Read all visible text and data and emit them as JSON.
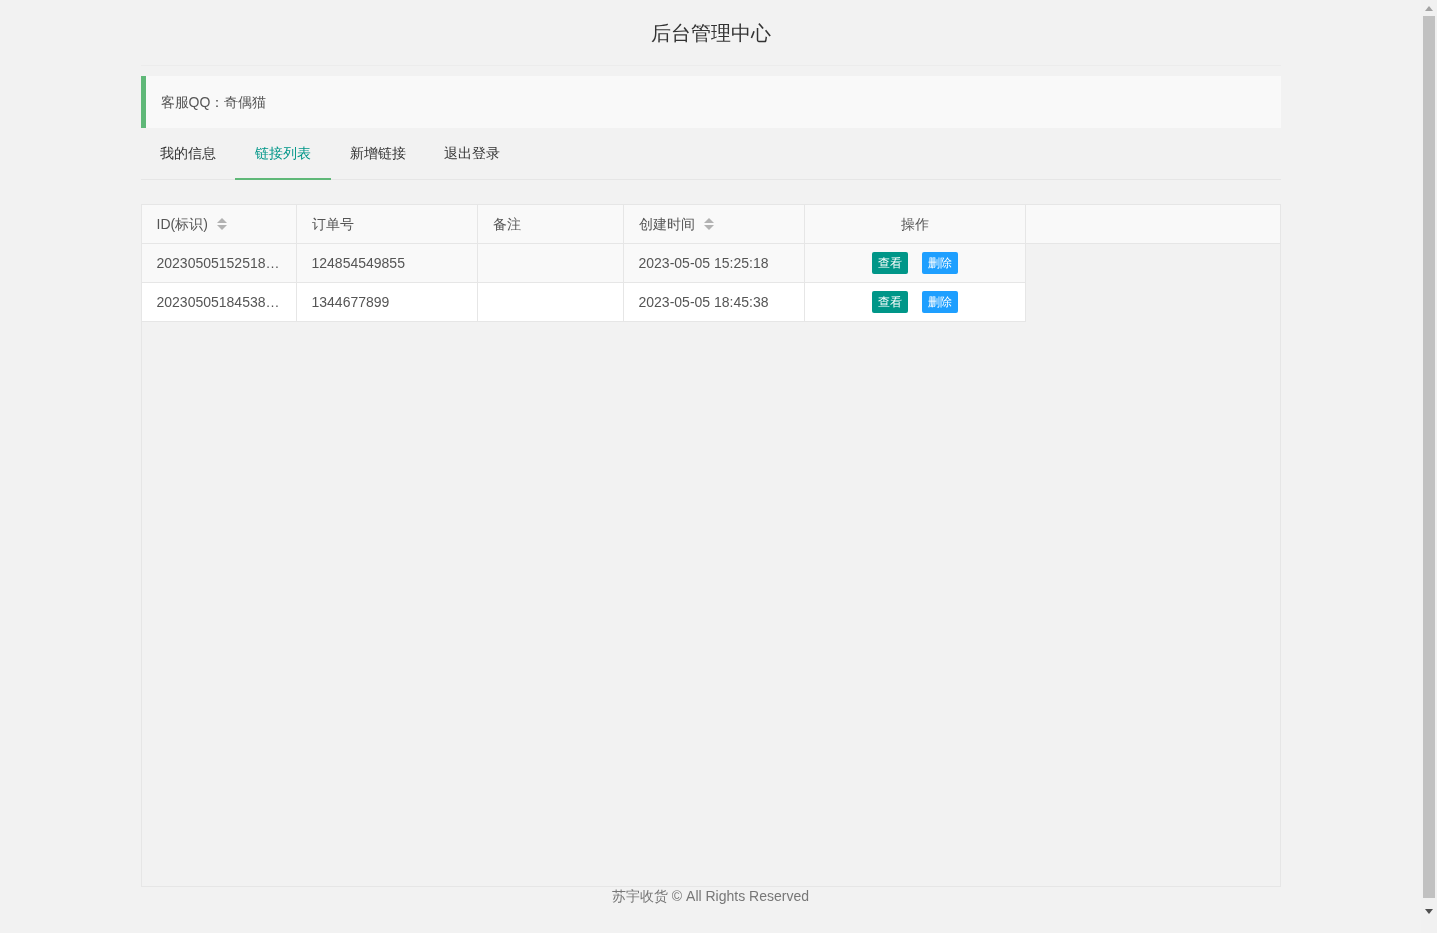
{
  "header": {
    "title": "后台管理中心"
  },
  "notice": {
    "text": "客服QQ：奇偶猫"
  },
  "tabs": [
    {
      "label": "我的信息",
      "selected": false
    },
    {
      "label": "链接列表",
      "selected": true
    },
    {
      "label": "新增链接",
      "selected": false
    },
    {
      "label": "退出登录",
      "selected": false
    }
  ],
  "table": {
    "columns": [
      {
        "label": "ID(标识)",
        "sortable": true
      },
      {
        "label": "订单号",
        "sortable": false
      },
      {
        "label": "备注",
        "sortable": false
      },
      {
        "label": "创建时间",
        "sortable": true
      },
      {
        "label": "操作",
        "sortable": false
      }
    ],
    "rows": [
      {
        "id": "20230505152518…",
        "order": "124854549855",
        "note": "",
        "created": "2023-05-05 15:25:18",
        "actions": [
          {
            "label": "查看",
            "kind": "view"
          },
          {
            "label": "删除",
            "kind": "delete"
          }
        ]
      },
      {
        "id": "20230505184538…",
        "order": "1344677899",
        "note": "",
        "created": "2023-05-05 18:45:38",
        "actions": [
          {
            "label": "查看",
            "kind": "view"
          },
          {
            "label": "删除",
            "kind": "delete"
          }
        ]
      }
    ]
  },
  "footer": {
    "text": "苏宇收货 © All Rights Reserved"
  }
}
